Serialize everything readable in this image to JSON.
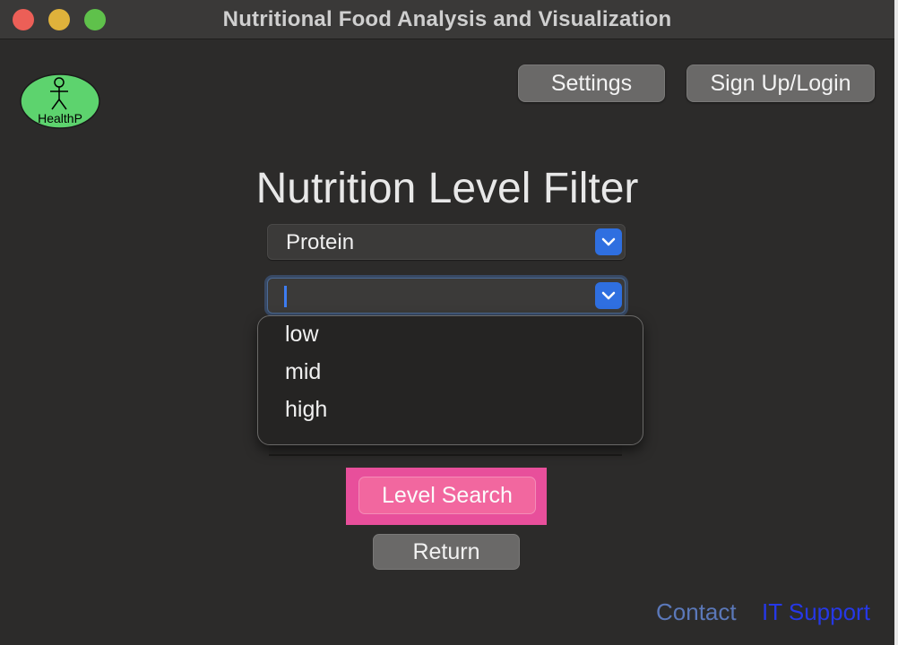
{
  "window": {
    "title": "Nutritional Food Analysis and Visualization"
  },
  "header": {
    "settings_label": "Settings",
    "signup_label": "Sign Up/Login",
    "logo_text": "HealthP"
  },
  "main": {
    "heading": "Nutrition Level Filter",
    "nutrient_select": {
      "selected": "Protein"
    },
    "level_select": {
      "selected": ""
    },
    "level_options": [
      "low",
      "mid",
      "high"
    ],
    "search_label": "Level Search",
    "return_label": "Return"
  },
  "footer": {
    "contact_label": "Contact",
    "it_support_label": "IT Support"
  },
  "colors": {
    "accent_blue": "#2f6fe0",
    "highlight_pink": "#e84f9b",
    "logo_green": "#5dd36e"
  },
  "icons": {
    "select_chevron": "chevron-down-icon",
    "logo": "stick-figure-icon"
  }
}
